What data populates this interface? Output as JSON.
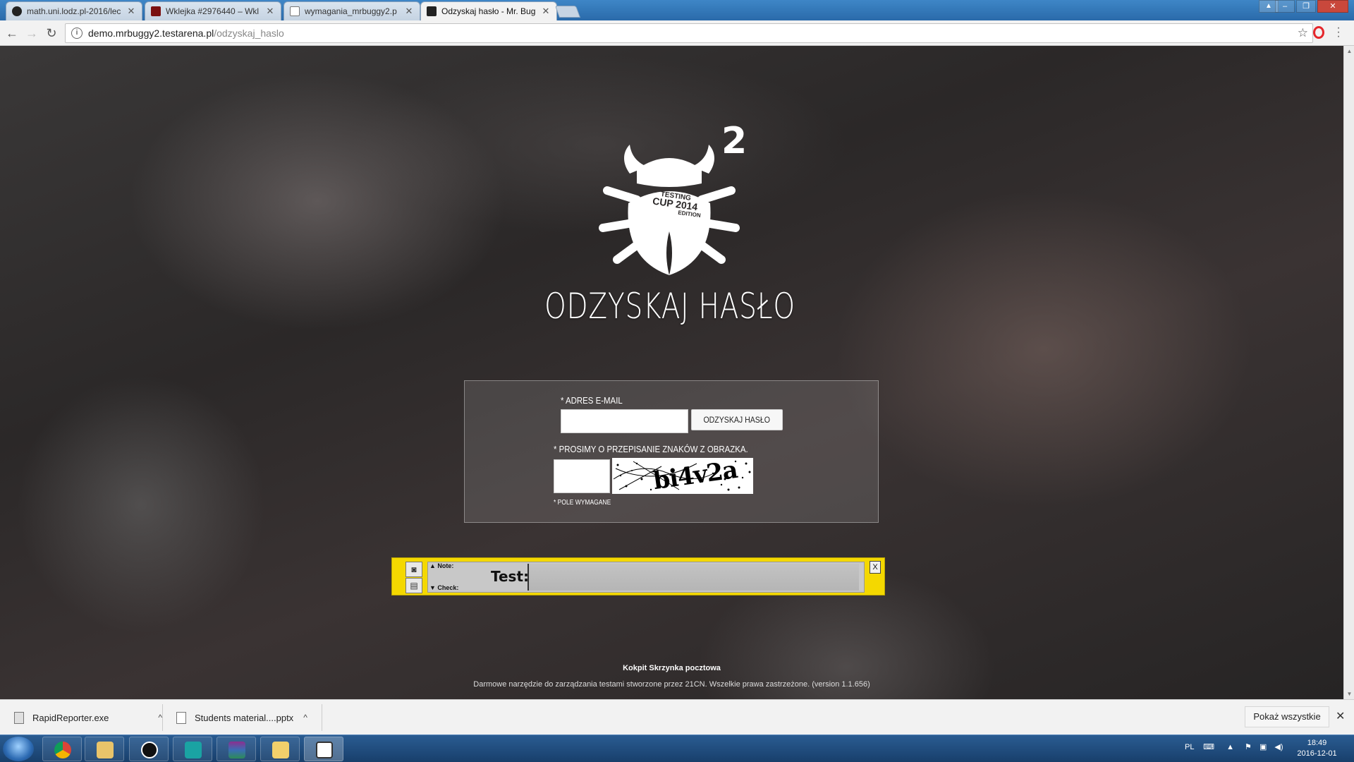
{
  "browser": {
    "tabs": [
      {
        "title": "math.uni.lodz.pl-2016/lec",
        "favicon": "github-icon"
      },
      {
        "title": "Wklejka #2976440 – Wkl",
        "favicon": "wklejka-icon"
      },
      {
        "title": "wymagania_mrbuggy2.p",
        "favicon": "document-icon"
      },
      {
        "title": "Odzyskaj hasło - Mr. Bug",
        "favicon": "bug-icon"
      }
    ],
    "tab_close": "✕",
    "url_host": "demo.mrbuggy2.testarena.pl",
    "url_path": "/odzyskaj_haslo"
  },
  "logo": {
    "superscript": "2",
    "badge_line1": "TESTING",
    "badge_line2": "CUP 2014",
    "badge_line3": "EDITION"
  },
  "page": {
    "title": "ODZYSKAJ HASŁO",
    "email_label": "* ADRES E-MAIL",
    "email_value": "",
    "submit_label": "ODZYSKAJ HASŁO",
    "captcha_label": "* PROSIMY O PRZEPISANIE ZNAKÓW Z OBRAZKA.",
    "captcha_value": "",
    "captcha_text": "bi4v2a",
    "required_note": "* POLE WYMAGANE",
    "footer_link1": "Kokpit",
    "footer_link2": "Skrzynka pocztowa",
    "footer_copy": "Darmowe narzędzie do zarządzania testami stworzone przez 21CN. Wszelkie prawa zastrzeżone. (version 1.1.656)"
  },
  "rapid_reporter": {
    "note_label": "▲ Note:",
    "check_label": "▼ Check:",
    "type_label": "Test:",
    "input_value": "",
    "close_label": "X"
  },
  "downloads": {
    "items": [
      {
        "name": "RapidReporter.exe",
        "icon": "exe-icon"
      },
      {
        "name": "Students material....pptx",
        "icon": "file-icon"
      }
    ],
    "show_all": "Pokaż wszystkie",
    "close": "✕"
  },
  "taskbar": {
    "apps": [
      "chrome",
      "explorer",
      "unreal",
      "maya",
      "winrar",
      "folder",
      "notepad"
    ],
    "language": "PL",
    "time": "18:49",
    "date": "2016-12-01"
  }
}
